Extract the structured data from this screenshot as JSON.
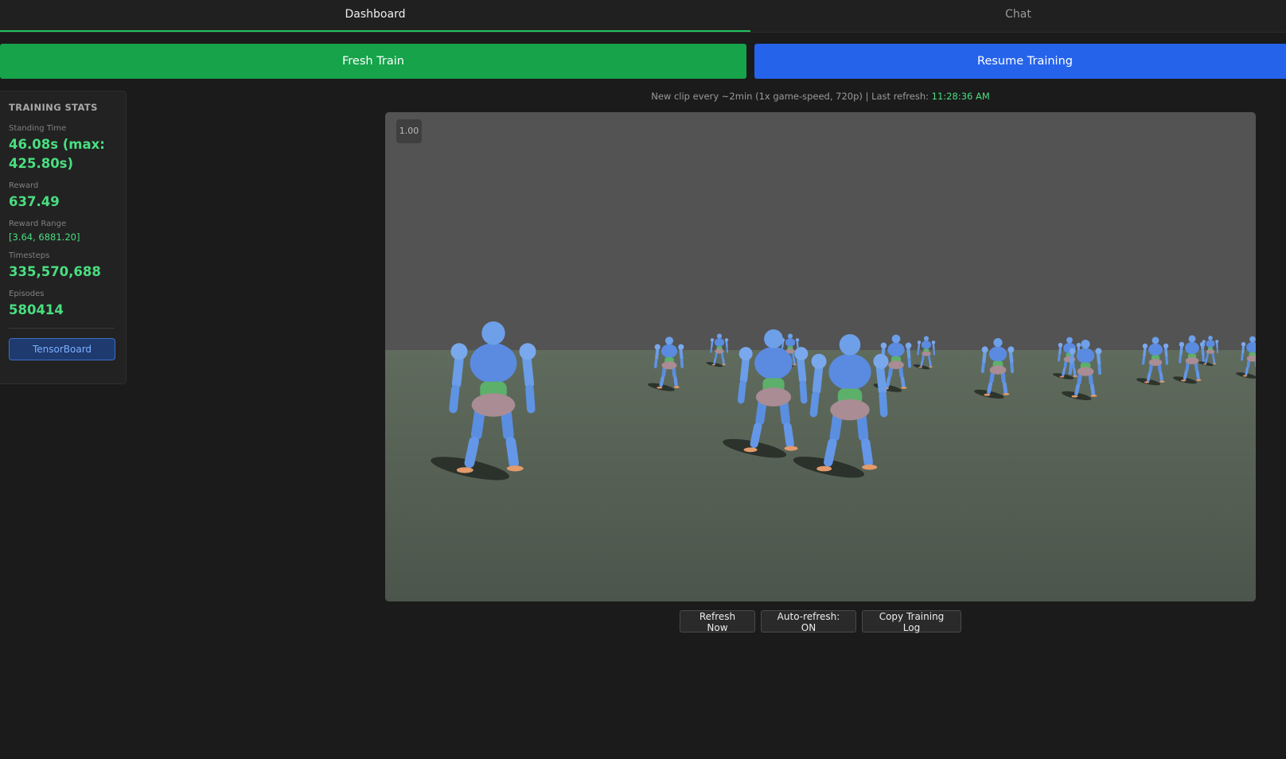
{
  "tabs": {
    "dashboard": "Dashboard",
    "chat": "Chat"
  },
  "actions": {
    "fresh_train": "Fresh Train",
    "resume_training": "Resume Training"
  },
  "stats": {
    "title": "TRAINING STATS",
    "standing_time": {
      "label": "Standing Time",
      "value": "46.08s (max: 425.80s)"
    },
    "reward": {
      "label": "Reward",
      "value": "637.49"
    },
    "reward_range": {
      "label": "Reward Range",
      "value": "[3.64, 6881.20]"
    },
    "timesteps": {
      "label": "Timesteps",
      "value": "335,570,688"
    },
    "episodes": {
      "label": "Episodes",
      "value": "580414"
    },
    "tensorboard": "TensorBoard"
  },
  "info": {
    "text": "New clip every ~2min (1x game-speed, 720p) | Last refresh: ",
    "time": "11:28:36 AM"
  },
  "viewport": {
    "speed": "1.00"
  },
  "controls": {
    "refresh_now": "Refresh Now",
    "auto_refresh": "Auto-refresh: ON",
    "copy_log": "Copy Training Log"
  },
  "colors": {
    "accent_green": "#22c55e",
    "fresh_train": "#16a34a",
    "resume_training": "#2563eb",
    "stat_value": "#4ade80"
  }
}
